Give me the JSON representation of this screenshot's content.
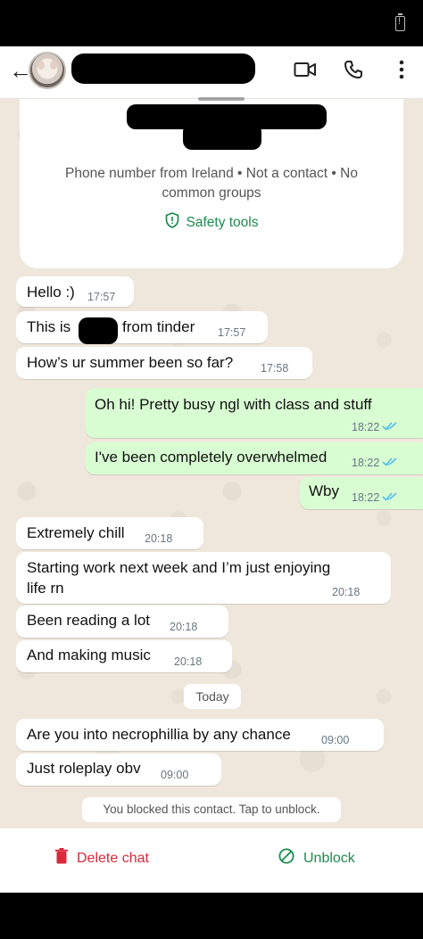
{
  "header": {
    "back_icon": "back-arrow-icon",
    "icons": [
      "video-call-icon",
      "phone-call-icon",
      "more-vert-icon"
    ]
  },
  "contact_card": {
    "info": "Phone number from Ireland • Not a contact • No common groups",
    "safety_label": "Safety tools"
  },
  "messages": [
    {
      "dir": "in",
      "text": "Hello :)",
      "time": "17:57"
    },
    {
      "dir": "in",
      "text_pre": "This is",
      "text_post": "from tinder",
      "time": "17:57"
    },
    {
      "dir": "in",
      "text": "How’s ur summer been so far?",
      "time": "17:58"
    },
    {
      "dir": "out",
      "text": "Oh hi! Pretty busy ngl with class and stuff",
      "time": "18:22"
    },
    {
      "dir": "out",
      "text": "I've been completely overwhelmed",
      "time": "18:22"
    },
    {
      "dir": "out",
      "text": "Wby",
      "time": "18:22"
    },
    {
      "dir": "in",
      "text": "Extremely chill",
      "time": "20:18"
    },
    {
      "dir": "in",
      "text_line1": "Starting work next week and I’m just enjoying",
      "text_line2": "life rn",
      "time": "20:18"
    },
    {
      "dir": "in",
      "text": "Been reading a lot",
      "time": "20:18"
    },
    {
      "dir": "in",
      "text": "And making music",
      "time": "20:18"
    },
    {
      "dir": "in",
      "text": "Are you into necrophillia by any chance",
      "time": "09:00"
    },
    {
      "dir": "in",
      "text": "Just roleplay obv",
      "time": "09:00"
    }
  ],
  "date_divider": "Today",
  "blocked_notice": "You blocked this contact. Tap to unblock.",
  "actions": {
    "delete_label": "Delete chat",
    "unblock_label": "Unblock"
  },
  "colors": {
    "outgoing_bubble": "#d9fdd3",
    "incoming_bubble": "#ffffff",
    "accent_green": "#1d8b4e",
    "danger_red": "#d9293a",
    "read_tick_blue": "#53bdeb"
  }
}
